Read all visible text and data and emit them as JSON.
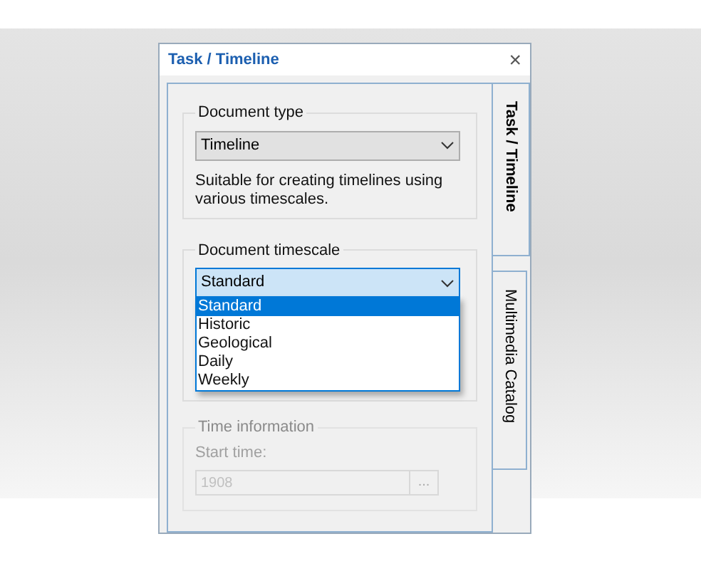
{
  "window": {
    "title": "Task / Timeline",
    "close": "×"
  },
  "tabs": [
    {
      "label": "Task / Timeline",
      "selected": true
    },
    {
      "label": "Multimedia Catalog",
      "selected": false
    }
  ],
  "document_type": {
    "label": "Document type",
    "value": "Timeline",
    "description": "Suitable for creating timelines using various timescales."
  },
  "document_timescale": {
    "label": "Document timescale",
    "value": "Standard",
    "expanded": true,
    "options": [
      {
        "label": "Standard",
        "selected": true
      },
      {
        "label": "Historic",
        "selected": false
      },
      {
        "label": "Geological",
        "selected": false
      },
      {
        "label": "Daily",
        "selected": false
      },
      {
        "label": "Weekly",
        "selected": false
      }
    ]
  },
  "time_information": {
    "label": "Time information",
    "disabled": true,
    "start_time_label": "Start time:",
    "start_time": "1908",
    "browse": "..."
  }
}
